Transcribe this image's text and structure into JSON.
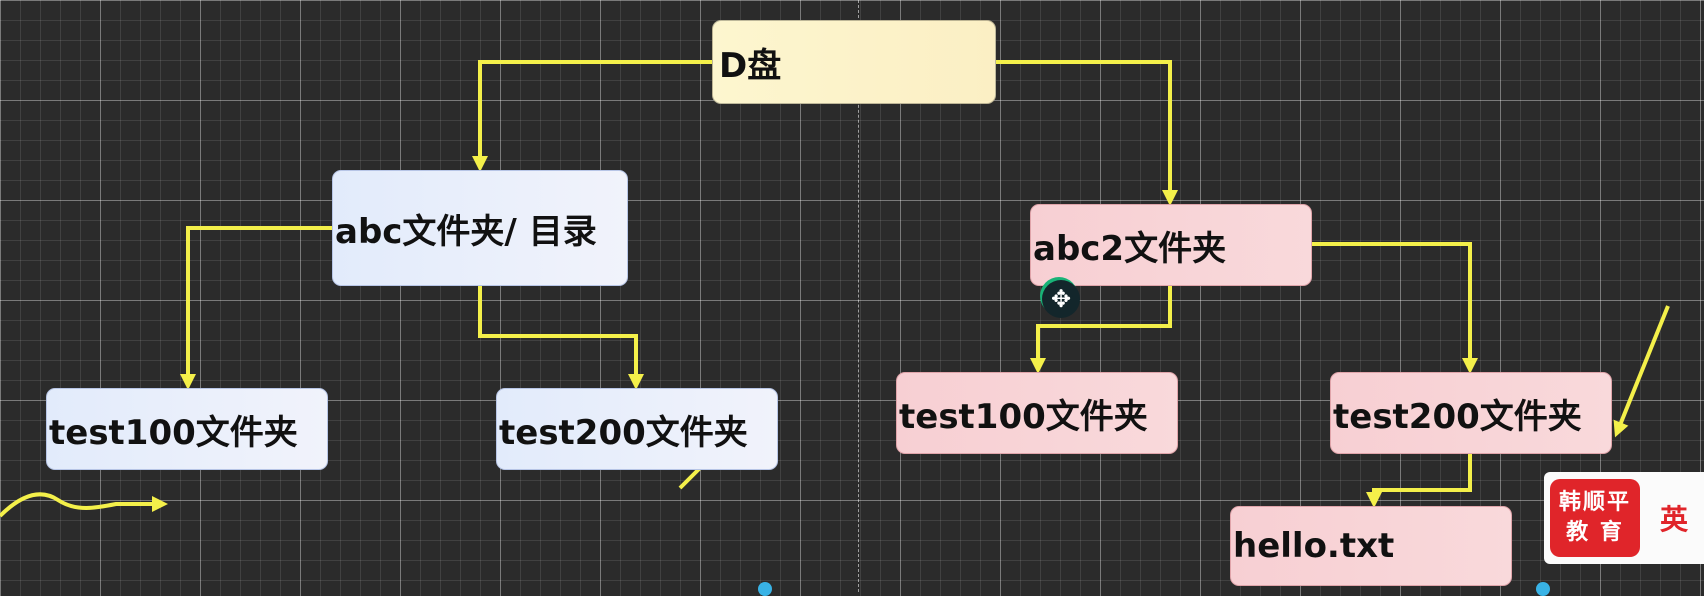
{
  "diagram": {
    "root": {
      "label": "D盘"
    },
    "left_branch": {
      "folder": {
        "label": "abc文件夹/ 目录"
      },
      "children": [
        {
          "label": "test100文件夹"
        },
        {
          "label": "test200文件夹"
        }
      ]
    },
    "right_branch": {
      "folder": {
        "label": "abc2文件夹"
      },
      "children": [
        {
          "label": "test100文件夹"
        },
        {
          "label": "test200文件夹"
        }
      ],
      "file": {
        "label": "hello.txt"
      }
    }
  },
  "watermark": {
    "line1": "韩顺平",
    "line2": "教 育",
    "side_text": "英"
  },
  "colors": {
    "background": "#2b2b2b",
    "arrow": "#f4f04a",
    "root_fill": "#fdf6cf",
    "blue_fill": "#e2ebfb",
    "pink_fill": "#f7cfd3",
    "logo_red": "#e0252a"
  },
  "icons": {
    "cursor": "move-cursor-icon"
  }
}
